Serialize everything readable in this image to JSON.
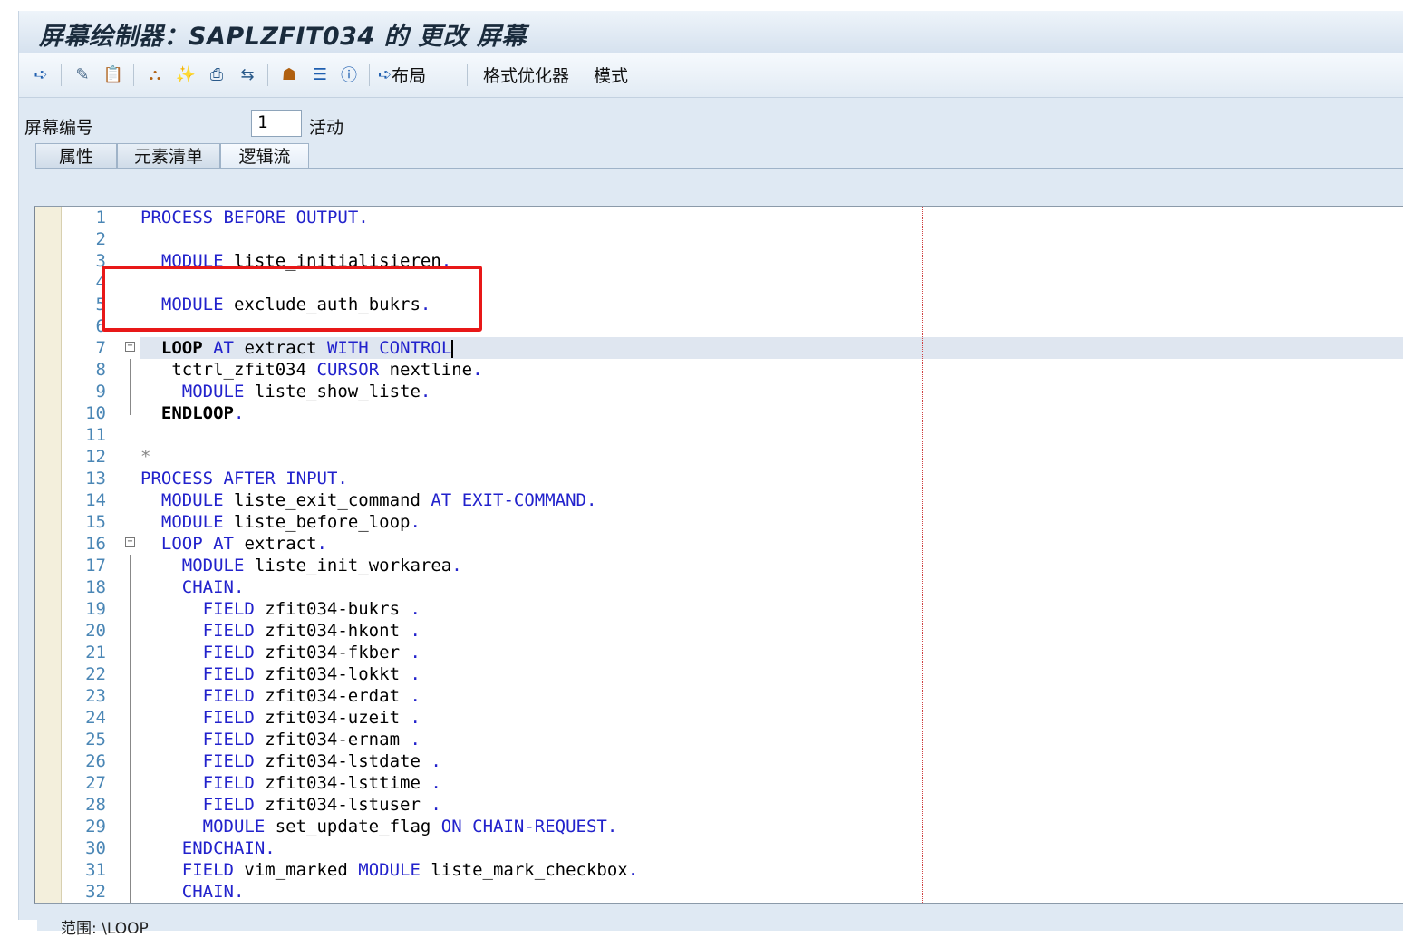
{
  "window": {
    "title": "屏幕绘制器：SAPLZFIT034 的 更改 屏幕"
  },
  "toolbar": {
    "icons": [
      "arrow-right-icon",
      "glasses-pen-icon",
      "clipboard-icon",
      "hierarchy-icon",
      "magic-wand-icon",
      "print-icon",
      "transfer-icon",
      "org-chart-icon",
      "stack-icon",
      "info-icon"
    ],
    "layout_label": "布局",
    "pretty_printer_label": "格式优化器",
    "pattern_label": "模式"
  },
  "screen": {
    "number_label": "屏幕编号",
    "number_value": "1",
    "status_label": "活动"
  },
  "tabs": [
    {
      "label": "属性"
    },
    {
      "label": "元素清单"
    },
    {
      "label": "逻辑流"
    }
  ],
  "editor": {
    "lines": [
      {
        "n": "1",
        "code": "PROCESS BEFORE OUTPUT."
      },
      {
        "n": "2",
        "code": ""
      },
      {
        "n": "3",
        "code": "  MODULE liste_initialisieren."
      },
      {
        "n": "4",
        "code": ""
      },
      {
        "n": "5",
        "code": "  MODULE exclude_auth_bukrs."
      },
      {
        "n": "6",
        "code": ""
      },
      {
        "n": "7",
        "code": "  LOOP AT extract WITH CONTROL"
      },
      {
        "n": "8",
        "code": "   tctrl_zfit034 CURSOR nextline."
      },
      {
        "n": "9",
        "code": "    MODULE liste_show_liste."
      },
      {
        "n": "10",
        "code": "  ENDLOOP."
      },
      {
        "n": "11",
        "code": ""
      },
      {
        "n": "12",
        "code": "*"
      },
      {
        "n": "13",
        "code": "PROCESS AFTER INPUT."
      },
      {
        "n": "14",
        "code": "  MODULE liste_exit_command AT EXIT-COMMAND."
      },
      {
        "n": "15",
        "code": "  MODULE liste_before_loop."
      },
      {
        "n": "16",
        "code": "  LOOP AT extract."
      },
      {
        "n": "17",
        "code": "    MODULE liste_init_workarea."
      },
      {
        "n": "18",
        "code": "    CHAIN."
      },
      {
        "n": "19",
        "code": "      FIELD zfit034-bukrs ."
      },
      {
        "n": "20",
        "code": "      FIELD zfit034-hkont ."
      },
      {
        "n": "21",
        "code": "      FIELD zfit034-fkber ."
      },
      {
        "n": "22",
        "code": "      FIELD zfit034-lokkt ."
      },
      {
        "n": "23",
        "code": "      FIELD zfit034-erdat ."
      },
      {
        "n": "24",
        "code": "      FIELD zfit034-uzeit ."
      },
      {
        "n": "25",
        "code": "      FIELD zfit034-ernam ."
      },
      {
        "n": "26",
        "code": "      FIELD zfit034-lstdate ."
      },
      {
        "n": "27",
        "code": "      FIELD zfit034-lsttime ."
      },
      {
        "n": "28",
        "code": "      FIELD zfit034-lstuser ."
      },
      {
        "n": "29",
        "code": "      MODULE set_update_flag ON CHAIN-REQUEST."
      },
      {
        "n": "30",
        "code": "    ENDCHAIN."
      },
      {
        "n": "31",
        "code": "    FIELD vim_marked MODULE liste_mark_checkbox."
      },
      {
        "n": "32",
        "code": "    CHAIN."
      }
    ]
  },
  "statusbar": {
    "text": "范围:  \\LOOP"
  },
  "colors": {
    "keyword": "#2222cc",
    "line_number": "#4a86b5",
    "highlight_box": "#e81818"
  }
}
